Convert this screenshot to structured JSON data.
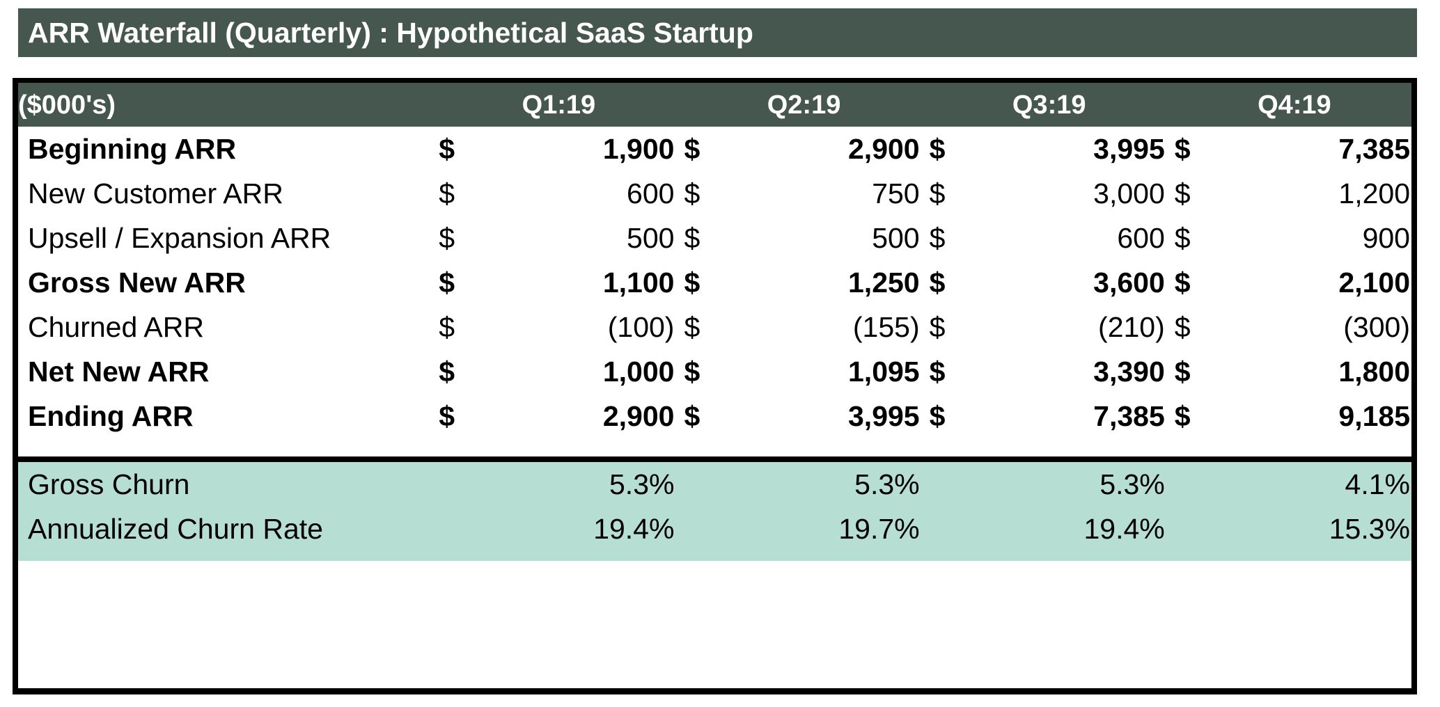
{
  "title": "ARR Waterfall (Quarterly) : Hypothetical SaaS Startup",
  "colors": {
    "header_band": "#465750",
    "footer_band": "#b7ded3",
    "border": "#000000",
    "title_text": "#ffffff",
    "body_text": "#000000"
  },
  "header": {
    "unit_label": "($000's)",
    "quarters": [
      "Q1:19",
      "Q2:19",
      "Q3:19",
      "Q4:19"
    ]
  },
  "currency_symbol": "$",
  "rows": [
    {
      "label": "Beginning ARR",
      "bold": true,
      "values": [
        "1,900",
        "2,900",
        "3,995",
        "7,385"
      ]
    },
    {
      "label": "New Customer ARR",
      "bold": false,
      "values": [
        "600",
        "750",
        "3,000",
        "1,200"
      ]
    },
    {
      "label": "Upsell / Expansion ARR",
      "bold": false,
      "values": [
        "500",
        "500",
        "600",
        "900"
      ]
    },
    {
      "label": "Gross New ARR",
      "bold": true,
      "values": [
        "1,100",
        "1,250",
        "3,600",
        "2,100"
      ]
    },
    {
      "label": "Churned ARR",
      "bold": false,
      "values": [
        "(100)",
        "(155)",
        "(210)",
        "(300)"
      ]
    },
    {
      "label": "Net New ARR",
      "bold": true,
      "values": [
        "1,000",
        "1,095",
        "3,390",
        "1,800"
      ]
    },
    {
      "label": "Ending ARR",
      "bold": true,
      "values": [
        "2,900",
        "3,995",
        "7,385",
        "9,185"
      ]
    }
  ],
  "footer_rows": [
    {
      "label": "Gross Churn",
      "values": [
        "5.3%",
        "5.3%",
        "5.3%",
        "4.1%"
      ]
    },
    {
      "label": "Annualized Churn Rate",
      "values": [
        "19.4%",
        "19.7%",
        "19.4%",
        "15.3%"
      ]
    }
  ],
  "chart_data": {
    "type": "table",
    "title": "ARR Waterfall (Quarterly) : Hypothetical SaaS Startup",
    "xlabel": "",
    "ylabel": "($000's)",
    "categories": [
      "Q1:19",
      "Q2:19",
      "Q3:19",
      "Q4:19"
    ],
    "series": [
      {
        "name": "Beginning ARR",
        "values": [
          1900,
          2900,
          3995,
          7385
        ]
      },
      {
        "name": "New Customer ARR",
        "values": [
          600,
          750,
          3000,
          1200
        ]
      },
      {
        "name": "Upsell / Expansion ARR",
        "values": [
          500,
          500,
          600,
          900
        ]
      },
      {
        "name": "Gross New ARR",
        "values": [
          1100,
          1250,
          3600,
          2100
        ]
      },
      {
        "name": "Churned ARR",
        "values": [
          -100,
          -155,
          -210,
          -300
        ]
      },
      {
        "name": "Net New ARR",
        "values": [
          1000,
          1095,
          3390,
          1800
        ]
      },
      {
        "name": "Ending ARR",
        "values": [
          2900,
          3995,
          7385,
          9185
        ]
      },
      {
        "name": "Gross Churn",
        "values": [
          5.3,
          5.3,
          5.3,
          4.1
        ],
        "unit": "%"
      },
      {
        "name": "Annualized Churn Rate",
        "values": [
          19.4,
          19.7,
          19.4,
          15.3
        ],
        "unit": "%"
      }
    ]
  }
}
